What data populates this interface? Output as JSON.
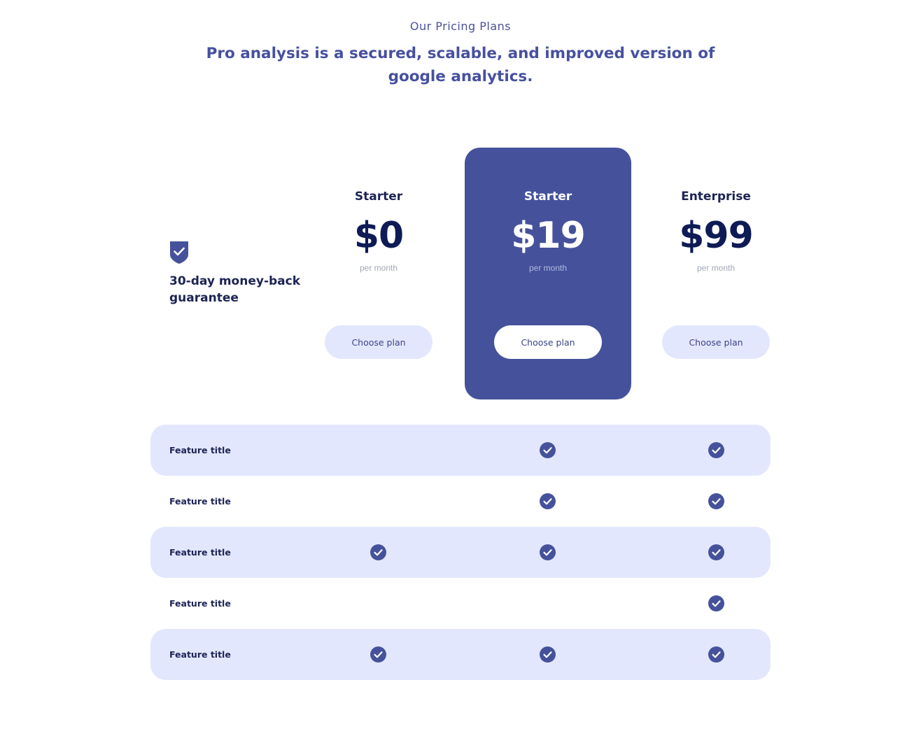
{
  "header": {
    "eyebrow": "Our Pricing Plans",
    "headline": "Pro analysis is a secured, scalable, and improved version of google analytics."
  },
  "guarantee": {
    "icon": "shield-check-icon",
    "text": "30-day money-back guarantee"
  },
  "plans": [
    {
      "name": "Starter",
      "price": "$0",
      "period": "per month",
      "button": "Choose plan",
      "featured": false
    },
    {
      "name": "Starter",
      "price": "$19",
      "period": "per month",
      "button": "Choose plan",
      "featured": true
    },
    {
      "name": "Enterprise",
      "price": "$99",
      "period": "per month",
      "button": "Choose plan",
      "featured": false
    }
  ],
  "features": [
    {
      "title": "Feature title",
      "included": [
        false,
        true,
        true
      ]
    },
    {
      "title": "Feature title",
      "included": [
        false,
        true,
        true
      ]
    },
    {
      "title": "Feature title",
      "included": [
        true,
        true,
        true
      ]
    },
    {
      "title": "Feature title",
      "included": [
        false,
        false,
        true
      ]
    },
    {
      "title": "Feature title",
      "included": [
        true,
        true,
        true
      ]
    }
  ],
  "colors": {
    "brand": "#45529b",
    "accent_light": "#e3e7fd",
    "text_dark": "#1c2454",
    "check": "#45529b"
  }
}
